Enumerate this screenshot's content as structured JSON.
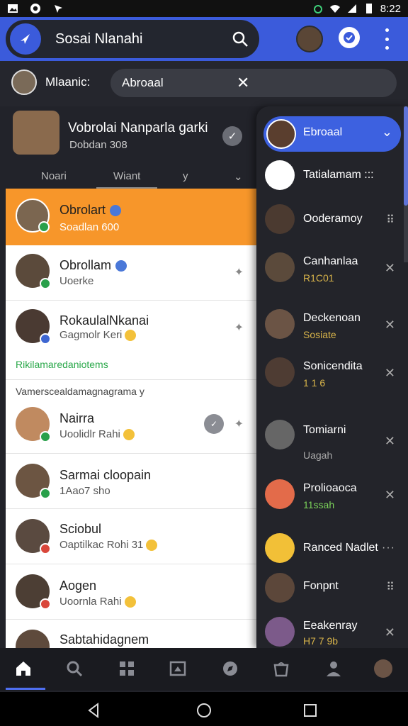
{
  "status_bar": {
    "time": "8:22"
  },
  "header": {
    "title": "Sosai Nlanahi"
  },
  "filter_row": {
    "user_name": "Mlaanic:",
    "chip_text": "Abroaal"
  },
  "conversation": {
    "title": "Vobrolai Nanparla garki",
    "subtitle": "Dobdan 308",
    "tabs": [
      "Noari",
      "Wiant",
      "y"
    ]
  },
  "list": {
    "items": [
      {
        "name": "Obrolart",
        "sub": "Soadlan 600",
        "active": true
      },
      {
        "name": "Obrollam",
        "sub": "Uoerke"
      },
      {
        "name": "RokaulalNkanai",
        "sub": "Gagmolr Keri"
      },
      {
        "name": "Nairra",
        "sub": "Uoolidlr Rahi"
      },
      {
        "name": "Sarmai cloopain",
        "sub": "1Aao7 sho"
      },
      {
        "name": "Sciobul",
        "sub": "Oaptilkac Rohi",
        "badge": "31"
      },
      {
        "name": "Aogen",
        "sub": "Uoornla Rahi"
      },
      {
        "name": "Sabtahidagnem",
        "sub": ""
      }
    ],
    "section_green": "Rikilamaredaniotems",
    "section_gray": "Vamerscealdamagnagrama y"
  },
  "drawer": {
    "items": [
      {
        "name": "Ebroaal",
        "sub": "",
        "active": true
      },
      {
        "name": "Tatialamam :::",
        "sub": ""
      },
      {
        "name": "Ooderamoy",
        "sub": ""
      },
      {
        "name": "Canhanlaa",
        "sub": "R1C01"
      },
      {
        "name": "Deckenoan",
        "sub": "Sosiate"
      },
      {
        "name": "Sonicendita",
        "sub": "1 1 6"
      },
      {
        "name": "Tomiarni",
        "sub": "Uagah"
      },
      {
        "name": "Prolioaoca",
        "sub": "11ssah",
        "sub_green": true
      },
      {
        "name": "Ranced Nadlet",
        "sub": ""
      },
      {
        "name": "Fonpnt",
        "sub": ""
      },
      {
        "name": "Eeakenray",
        "sub": "H7 7 9b"
      }
    ]
  },
  "colors": {
    "accent": "#3b5bdb",
    "active_item": "#f7962a",
    "drawer_active": "#3d61e0"
  }
}
